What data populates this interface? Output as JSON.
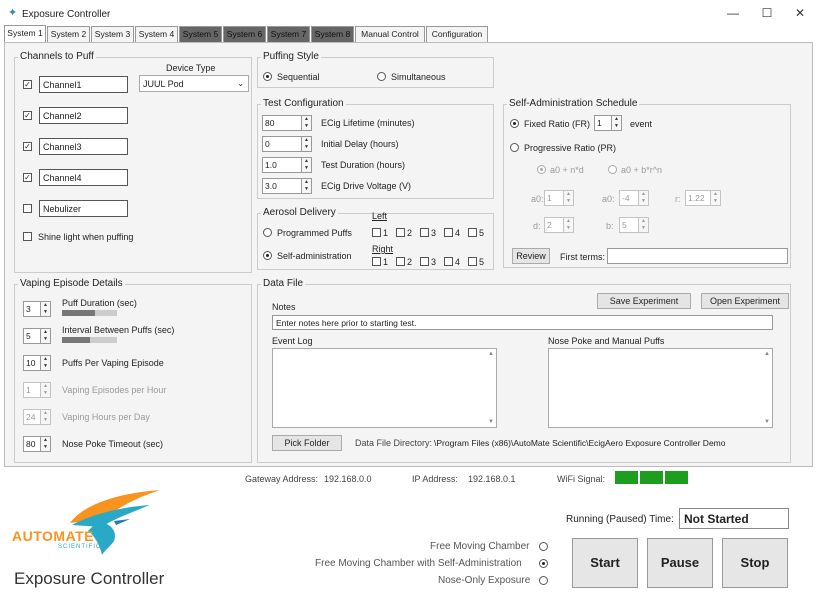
{
  "window": {
    "title": "Exposure Controller",
    "minimize": "—",
    "maximize": "☐",
    "close": "✕"
  },
  "tabs": [
    "System 1",
    "System 2",
    "System 3",
    "System 4",
    "System 5",
    "System 6",
    "System 7",
    "System 8",
    "Manual Control",
    "Configuration"
  ],
  "channels": {
    "title": "Channels to Puff",
    "device_type_label": "Device Type",
    "device_type_value": "JUUL Pod",
    "items": [
      {
        "label": "Channel1",
        "checked": true
      },
      {
        "label": "Channel2",
        "checked": true
      },
      {
        "label": "Channel3",
        "checked": true
      },
      {
        "label": "Channel4",
        "checked": true
      },
      {
        "label": "Nebulizer",
        "checked": false
      }
    ],
    "shine_light": "Shine light when puffing"
  },
  "puffing_style": {
    "title": "Puffing Style",
    "sequential": "Sequential",
    "simultaneous": "Simultaneous"
  },
  "test_config": {
    "title": "Test Configuration",
    "rows": [
      {
        "value": "80",
        "label": "ECig Lifetime (minutes)"
      },
      {
        "value": "0",
        "label": "Initial Delay (hours)"
      },
      {
        "value": "1.0",
        "label": "Test Duration (hours)"
      },
      {
        "value": "3.0",
        "label": "ECig Drive Voltage (V)"
      }
    ]
  },
  "aerosol": {
    "title": "Aerosol Delivery",
    "programmed": "Programmed Puffs",
    "self_admin": "Self-administration",
    "left": "Left",
    "right": "Right",
    "ports": [
      "1",
      "2",
      "3",
      "4",
      "5"
    ]
  },
  "schedule": {
    "title": "Self-Administration Schedule",
    "fixed_ratio": "Fixed Ratio (FR)",
    "fr_value": "1",
    "event": "event",
    "progressive": "Progressive Ratio (PR)",
    "formula1": "a0 + n*d",
    "formula2": "a0 + b*r^n",
    "a0_label": "a0:",
    "a0_value": "1",
    "a0b_label": "a0:",
    "a0b_value": "-4",
    "r_label": "r:",
    "r_value": "1.22",
    "d_label": "d:",
    "d_value": "2",
    "b_label": "b:",
    "b_value": "5",
    "review": "Review",
    "first_terms": "First terms:"
  },
  "vaping": {
    "title": "Vaping Episode Details",
    "rows": [
      {
        "value": "3",
        "label": "Puff Duration (sec)",
        "slider": 0.6,
        "disabled": false
      },
      {
        "value": "5",
        "label": "Interval Between Puffs (sec)",
        "slider": 0.5,
        "disabled": false
      },
      {
        "value": "10",
        "label": "Puffs Per Vaping Episode",
        "disabled": false
      },
      {
        "value": "1",
        "label": "Vaping Episodes per Hour",
        "disabled": true
      },
      {
        "value": "24",
        "label": "Vaping Hours per Day",
        "disabled": true
      },
      {
        "value": "80",
        "label": "Nose Poke Timeout (sec)",
        "disabled": false
      }
    ]
  },
  "data_file": {
    "title": "Data File",
    "notes_label": "Notes",
    "save": "Save Experiment",
    "open": "Open Experiment",
    "notes_value": "Enter notes here prior to starting test.",
    "event_log": "Event Log",
    "nose_poke": "Nose Poke and Manual Puffs",
    "pick_folder": "Pick Folder",
    "dir_label": "Data File Directory:",
    "dir_value": "\\Program Files (x86)\\AutoMate Scientific\\EcigAero Exposure Controller Demo"
  },
  "status": {
    "gateway_label": "Gateway Address:",
    "gateway": "192.168.0.0",
    "ip_label": "IP Address:",
    "ip": "192.168.0.1",
    "wifi_label": "WiFi Signal:"
  },
  "brand": {
    "logo_word": "AUTOMATE",
    "logo_sub": "SCIENTIFIC",
    "app_name": "Exposure Controller"
  },
  "running": {
    "label": "Running (Paused) Time:",
    "value": "Not Started"
  },
  "chamber": {
    "options": [
      {
        "label": "Free Moving Chamber",
        "selected": false
      },
      {
        "label": "Free Moving Chamber with Self-Administration",
        "selected": true
      },
      {
        "label": "Nose-Only Exposure",
        "selected": false
      }
    ]
  },
  "controls": {
    "start": "Start",
    "pause": "Pause",
    "stop": "Stop"
  },
  "colors": {
    "wifi": "#1e9e1e",
    "logo_orange": "#f7931e",
    "logo_teal": "#29a9c5"
  }
}
